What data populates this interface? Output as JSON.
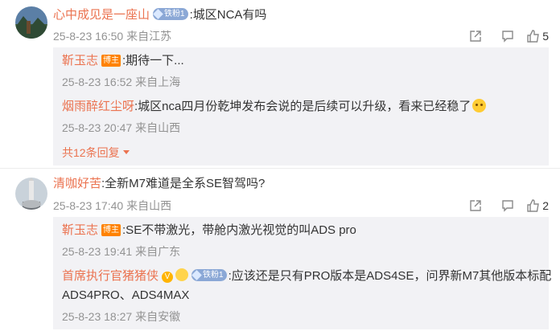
{
  "comments": [
    {
      "avatar_icon": "mountain-landscape-avatar",
      "user": "心中成见是一座山",
      "fan_badge": "铁粉1",
      "text": ":城区NCA有吗",
      "time": "25-8-23 16:50",
      "location": "来自江苏",
      "like_count": "5",
      "replies": [
        {
          "user": "靳玉志",
          "host_badge": "博主",
          "text": ":期待一下...",
          "time": "25-8-23 16:52",
          "location": "来自上海"
        },
        {
          "user": "烟雨醉红尘呀",
          "text": ":城区nca四月份乾坤发布会说的是后续可以升级，看来已经稳了",
          "emoji": "grin-emoji",
          "time": "25-8-23 20:47",
          "location": "来自山西"
        }
      ],
      "more_replies": "共12条回复"
    },
    {
      "avatar_icon": "rocket-launch-avatar",
      "user": "清咖好苦",
      "text": ":全新M7难道是全系SE智驾吗?",
      "time": "25-8-23 17:40",
      "location": "来自山西",
      "like_count": "2",
      "replies": [
        {
          "user": "靳玉志",
          "host_badge": "博主",
          "text": ":SE不带激光，带舱内激光视觉的叫ADS pro",
          "time": "25-8-23 19:41",
          "location": "来自广东"
        },
        {
          "user": "首席执行官猪猪侠",
          "verified_badge": "V",
          "fan_badge": "铁粉1",
          "text": ":应该还是只有PRO版本是ADS4SE，问界新M7其他版本标配",
          "text_line2": "ADS4PRO、ADS4MAX",
          "time": "25-8-23 18:27",
          "location": "来自安徽"
        }
      ]
    }
  ],
  "colors": {
    "username": "#eb7350",
    "meta": "#939393",
    "reply_bg": "#f2f2f5",
    "host_badge": "#ff8200"
  }
}
